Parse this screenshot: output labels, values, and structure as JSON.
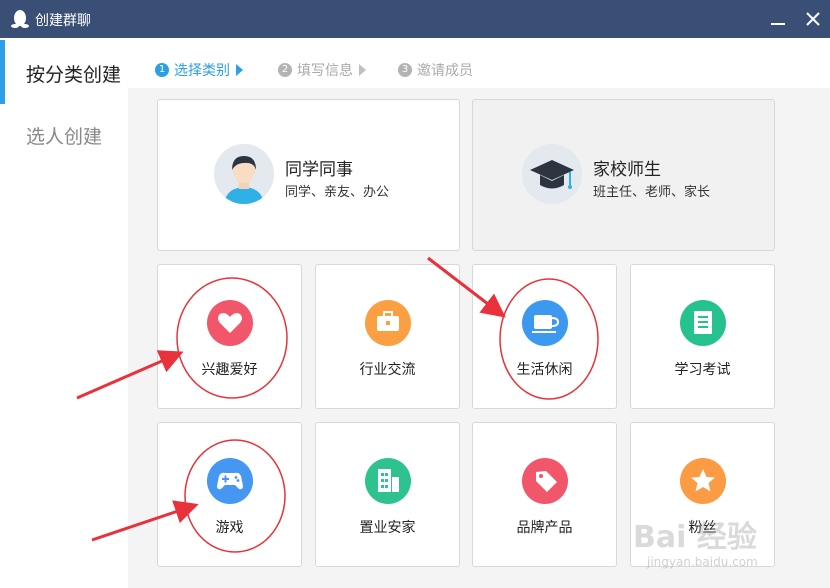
{
  "window": {
    "title": "创建群聊"
  },
  "sidebar": {
    "items": [
      {
        "label": "按分类创建",
        "active": true
      },
      {
        "label": "选人创建",
        "active": false
      }
    ]
  },
  "steps": [
    {
      "num": "1",
      "label": "选择类别",
      "active": true
    },
    {
      "num": "2",
      "label": "填写信息",
      "active": false
    },
    {
      "num": "3",
      "label": "邀请成员",
      "active": false
    }
  ],
  "big_categories": [
    {
      "title": "同学同事",
      "subtitle": "同学、亲友、办公",
      "icon": "student-avatar-icon"
    },
    {
      "title": "家校师生",
      "subtitle": "班主任、老师、家长",
      "icon": "graduation-cap-icon"
    }
  ],
  "categories": [
    {
      "label": "兴趣爱好",
      "icon": "heart-icon",
      "color": "#f2566b"
    },
    {
      "label": "行业交流",
      "icon": "briefcase-icon",
      "color": "#fb9f43"
    },
    {
      "label": "生活休闲",
      "icon": "coffee-cup-icon",
      "color": "#3d98f0"
    },
    {
      "label": "学习考试",
      "icon": "document-icon",
      "color": "#25c28f"
    },
    {
      "label": "游戏",
      "icon": "gamepad-icon",
      "color": "#4597f1"
    },
    {
      "label": "置业安家",
      "icon": "building-icon",
      "color": "#2ec28e"
    },
    {
      "label": "品牌产品",
      "icon": "tag-icon",
      "color": "#f2566b"
    },
    {
      "label": "粉丝",
      "icon": "star-icon",
      "color": "#fb9b43"
    }
  ],
  "watermark": {
    "main": "Bai 经验",
    "url": "jingyan.baidu.com"
  },
  "colors": {
    "titlebar": "#3a4f76",
    "accent": "#2a9fe6",
    "annotation": "#e8313a"
  }
}
